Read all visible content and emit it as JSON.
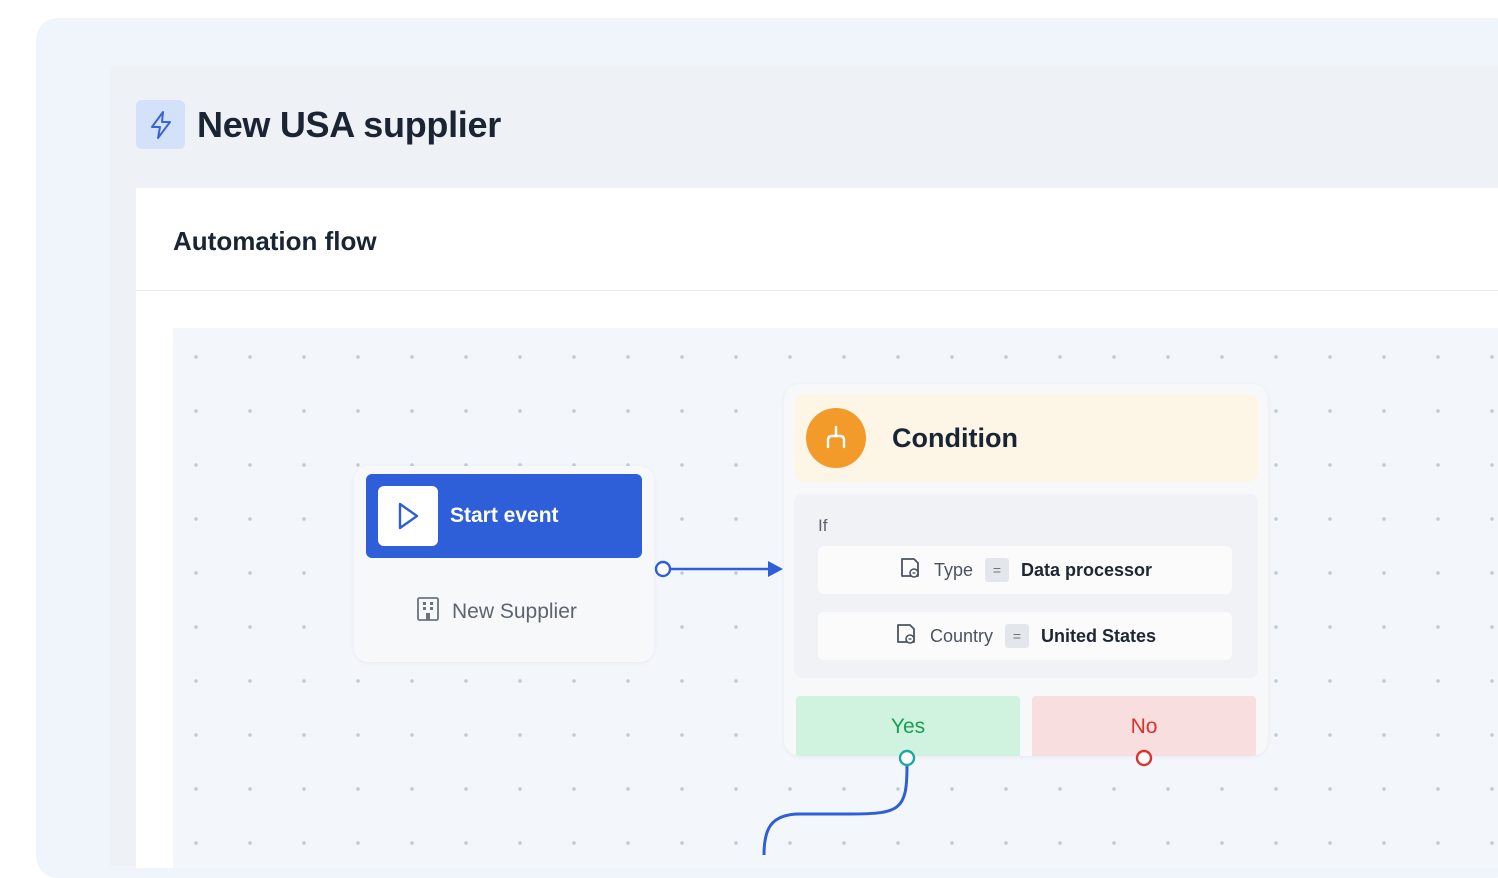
{
  "page": {
    "title": "New USA supplier",
    "title_icon": "lightning-icon"
  },
  "card": {
    "title": "Automation flow"
  },
  "start_node": {
    "label": "Start event",
    "icon": "play-icon",
    "subtitle": "New Supplier",
    "subtitle_icon": "building-icon"
  },
  "condition_node": {
    "title": "Condition",
    "icon": "branch-icon",
    "if_label": "If",
    "rules": [
      {
        "field": "Type",
        "operator": "=",
        "value": "Data processor",
        "icon": "document-icon"
      },
      {
        "field": "Country",
        "operator": "=",
        "value": "United States",
        "icon": "document-icon"
      }
    ],
    "yes_label": "Yes",
    "no_label": "No"
  },
  "colors": {
    "primary": "#2f5fd8",
    "condition_accent": "#f29b2b",
    "yes_text": "#1b9e54",
    "yes_bg": "#cff3df",
    "no_text": "#d9342b",
    "no_bg": "#f8dede"
  }
}
